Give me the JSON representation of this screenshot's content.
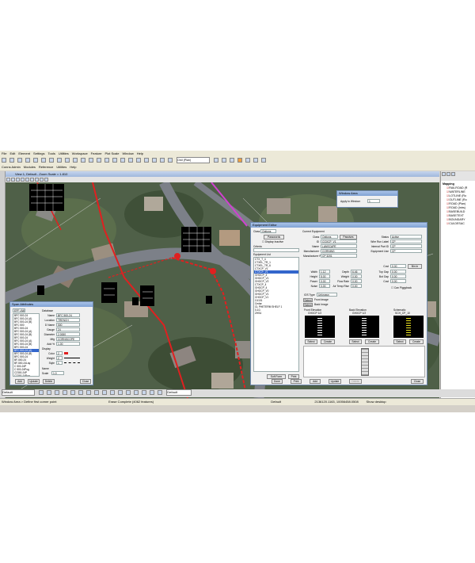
{
  "menu": [
    "File",
    "Edit",
    "Element",
    "Settings",
    "Tools",
    "Utilities",
    "Workspace",
    "Feature",
    "Plot Scale",
    "Window",
    "Help"
  ],
  "toolbar": {
    "level_value": "Civil (Plan)"
  },
  "second_toolbar": [
    "Conns Admin",
    "Modules",
    "Reference",
    "Utilities",
    "Help"
  ],
  "view": {
    "title": "View 1, Default - Zoom Scale = 1.810"
  },
  "window_area": {
    "title": "Window Area",
    "apply_label": "Apply to Window:",
    "apply_value": "1"
  },
  "equipment_editor": {
    "title": "Equipment Editor",
    "class_label": "Class",
    "class_value": "Options",
    "passwords_button": "Passwords",
    "display_inactive_label": "Display Inactive",
    "criteria_label": "Criteria",
    "equipment_list_label": "Equipment List",
    "equipment_list": [
      "CTX_T_4",
      "CTXEL_TR_1",
      "CTXEL_TR_6",
      "CTXCP_V1",
      "CTXCP_V1",
      "GHOCP_4",
      "GHOCP_V1",
      "GHOCP_V2",
      "CTXCP_4",
      "GHOCP_4",
      "GHOCP_V0",
      "GHOCP_V1",
      "CHOCP_V1",
      "C4101",
      "Cedar",
      "CL PHETERM SHELF 1",
      "0-10-",
      "ZHS4"
    ],
    "current_equipment_label": "Current Equipment",
    "fields_left": [
      {
        "label": "Class",
        "value": "Options"
      },
      {
        "label": "ID",
        "value": "CGXCP_V1"
      },
      {
        "label": "Name",
        "value": "LANSCAPE"
      },
      {
        "label": "Manufacturer",
        "value": "CORNING"
      },
      {
        "label": "Manufacturer Part #",
        "value": "CP 3201"
      }
    ],
    "passives_button": "Passives",
    "fields_right": [
      {
        "label": "Status",
        "value": "Active"
      },
      {
        "label": "Wire Run Label",
        "value": "CP"
      },
      {
        "label": "Internal Part ID",
        "value": "CP"
      },
      {
        "label": "Equipment Use",
        "value": "CP"
      }
    ],
    "dims": [
      {
        "l1": "Width",
        "v1": "1.12",
        "l2": "Depth",
        "v2": "6.46",
        "l3": "Top Gap",
        "v3": "0.00"
      },
      {
        "l1": "Height",
        "v1": "5.00",
        "l2": "Weight",
        "v2": "0.00",
        "l3": "Bot Gap",
        "v3": "0.00"
      },
      {
        "l1": "Power",
        "v1": "0.00",
        "l2": "Flow Rate",
        "v2": "0.00",
        "l3": "Cost",
        "v3": "0.00"
      },
      {
        "l1": "Noise",
        "v1": "0.00",
        "l2": "Air Temp Rise",
        "v2": "0.00",
        "l3": "",
        "v3": ""
      }
    ],
    "cost_label": "Cost",
    "cost_value": "0.00",
    "bin_button": "Bin In",
    "can_piggyback_label": "Can Piggyback",
    "ios_type_label": "IOS Type",
    "ios_type_value": "Unknown",
    "select_front_button": "Select",
    "front_image_label": "Front Image",
    "select_back_button": "Select",
    "back_image_label": "Back Image",
    "front_elevation_label": "Front Elevation",
    "front_elevation_sub": "GHXCP 1/2",
    "back_elevation_label": "Back Elevation",
    "back_elevation_sub": "GHXCP 1/2",
    "schematic_label": "Schematic",
    "schematic_sub": "SCH_CP_10",
    "select_button": "Select",
    "create_button": "Create",
    "soft_form_button": "Soft Form",
    "print_button": "Print",
    "footer_buttons": [
      "Done",
      "Print",
      "Add",
      "Update",
      "Delete"
    ],
    "close_button": "Close"
  },
  "span_attributes": {
    "title": "Span Attributes",
    "filter_label": "EPF (All)",
    "list": [
      "BFC 500-24",
      "BFC 500-24 (A)",
      "BFC 500-24 (B)",
      "BFC 500",
      "BFC 500-24",
      "BFC 500-24 (A)",
      "BFC 500-24 (B)",
      "BFC 500-24",
      "BFC 500-24 (A)",
      "BFC 500-24 (B)",
      "BFC 500-24",
      "BFC 500-24 (A)",
      "BFC 500-24 (B)",
      "BFC 500-24",
      "BF-500-24",
      "BF-500-24Lay",
      "C 500-24P",
      "C 500-24Pog",
      "C2300-24P",
      "C2300-24Pog"
    ],
    "selected_index": 11,
    "database_label": "Database",
    "name_label": "Name",
    "name_value": "BFC 500-24",
    "location_label": "Location",
    "location_value": "TRENCH",
    "dname_label": "D Name",
    "dname_value": "500",
    "gauge_label": "Gauge",
    "gauge_value": "24",
    "diameter_label": "Diameter",
    "diameter_value": "2.0000",
    "mfg_label": "Mfg",
    "mfg_value": "CORNSCOPE",
    "add_label": "Add %",
    "add_value": "1.00",
    "display_label": "Display",
    "color_label": "Color",
    "color_value": "2",
    "weight_label": "Weight",
    "weight_value": "2",
    "style_label": "Style",
    "style_value": "1",
    "name2_label": "Name",
    "scale_label": "Scale",
    "scale_value": "1.0",
    "buttons": [
      "Add",
      "Update",
      "Delete"
    ],
    "close_button": "Close"
  },
  "right_panel": {
    "title": "Mapping",
    "items": [
      "RAILROAD (R",
      "WATERLINE",
      "LOTLINE (Ro",
      "OUTLINE (Ro",
      "ROAD (Plan)",
      "ROAD (Intrs)",
      "BASEBUILD",
      "BASETEXT",
      "BOUNDARY",
      "CULDESAC"
    ]
  },
  "bottom_toolbar": {
    "left_value": "Default",
    "right_value": "Default"
  },
  "status": {
    "left": "Window Area > Define first corner point",
    "middle": "Erase Complete (4062 features)",
    "level": "Default",
    "coords": "2136120.1163, 10056458.0508",
    "show_desktop": "Show desktop"
  },
  "colors": {
    "accent": "#3366cc",
    "route_red": "#e02020",
    "route_magenta": "#d040d0",
    "map_bg": "#4a5a42"
  }
}
